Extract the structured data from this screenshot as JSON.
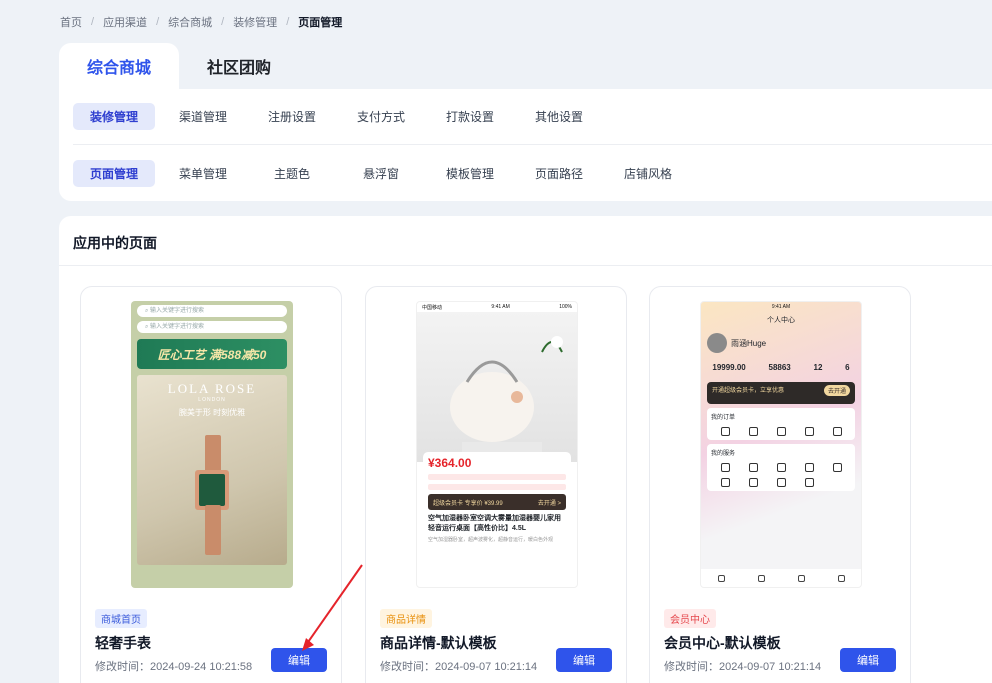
{
  "breadcrumb": [
    "首页",
    "应用渠道",
    "综合商城",
    "装修管理",
    "页面管理"
  ],
  "top_tabs": [
    {
      "label": "综合商城",
      "active": true
    },
    {
      "label": "社区团购",
      "active": false
    }
  ],
  "nav_row1": [
    "装修管理",
    "渠道管理",
    "注册设置",
    "支付方式",
    "打款设置",
    "其他设置"
  ],
  "nav_row2": [
    "页面管理",
    "菜单管理",
    "主题色",
    "悬浮窗",
    "模板管理",
    "页面路径",
    "店铺风格"
  ],
  "section_title": "应用中的页面",
  "cards": [
    {
      "badge": "商城首页",
      "name": "轻奢手表",
      "time": "修改时间：2024-09-24 10:21:58",
      "edit": "编辑",
      "thumb": {
        "search_placeholder": "输入关键字进行搜索",
        "promo": "匠心工艺 满588减50",
        "brand": "LOLA ROSE",
        "brand_sub": "LONDON",
        "slogan": "腕美于形 时刻优雅"
      }
    },
    {
      "badge": "商品详情",
      "name": "商品详情-默认模板",
      "time": "修改时间：2024-09-07 10:21:14",
      "edit": "编辑",
      "thumb": {
        "status_left": "中国移动",
        "status_time": "9:41 AM",
        "status_right": "100%",
        "price": "¥364.00",
        "vip": "超级会员卡 专享价 ¥39.99",
        "vip_action": "去开通 >",
        "product_name": "空气加湿器卧室空调大雾量加湿器婴儿家用轻音运行桌面【高性价比】4.5L",
        "product_desc": "空气加湿器卧室，超声波雾化，超静音运行，暖白色外观"
      }
    },
    {
      "badge": "会员中心",
      "name": "会员中心-默认模板",
      "time": "修改时间：2024-09-07 10:21:14",
      "edit": "编辑",
      "thumb": {
        "status_time": "9:41 AM",
        "page_title": "个人中心",
        "user_name": "雨涵Huge",
        "stats": [
          "19999.00",
          "58863",
          "12",
          "6"
        ],
        "vip_text": "开通超级会员卡，立享优惠",
        "vip_btn": "去开通",
        "orders_title": "我的订单",
        "services_title": "我的服务"
      }
    }
  ],
  "colors": {
    "accent": "#2f54eb",
    "arrow": "#e5242b"
  }
}
